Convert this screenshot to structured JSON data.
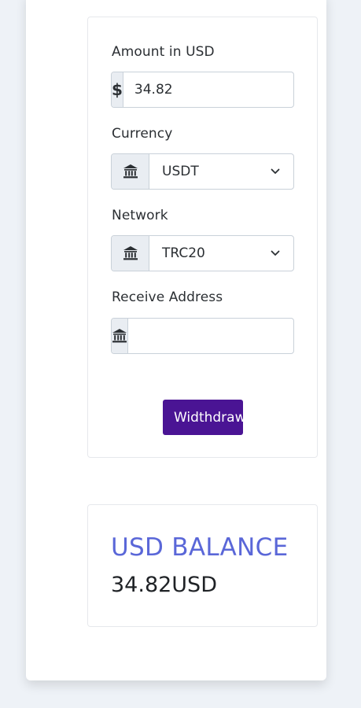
{
  "form": {
    "amount": {
      "label": "Amount in USD",
      "prefix": "$",
      "value": "34.82"
    },
    "currency": {
      "label": "Currency",
      "value": "USDT"
    },
    "network": {
      "label": "Network",
      "value": "TRC20"
    },
    "receive_address": {
      "label": "Receive Address",
      "value": "",
      "placeholder": ""
    },
    "submit_label": "Widthdraw"
  },
  "balance": {
    "title": "USD BALANCE",
    "value": "34.82USD"
  },
  "colors": {
    "accent": "#4a1494",
    "balance_title": "#5a67d8"
  },
  "icons": {
    "addon_bank": "bank-icon",
    "dropdown": "chevron-down-icon"
  }
}
